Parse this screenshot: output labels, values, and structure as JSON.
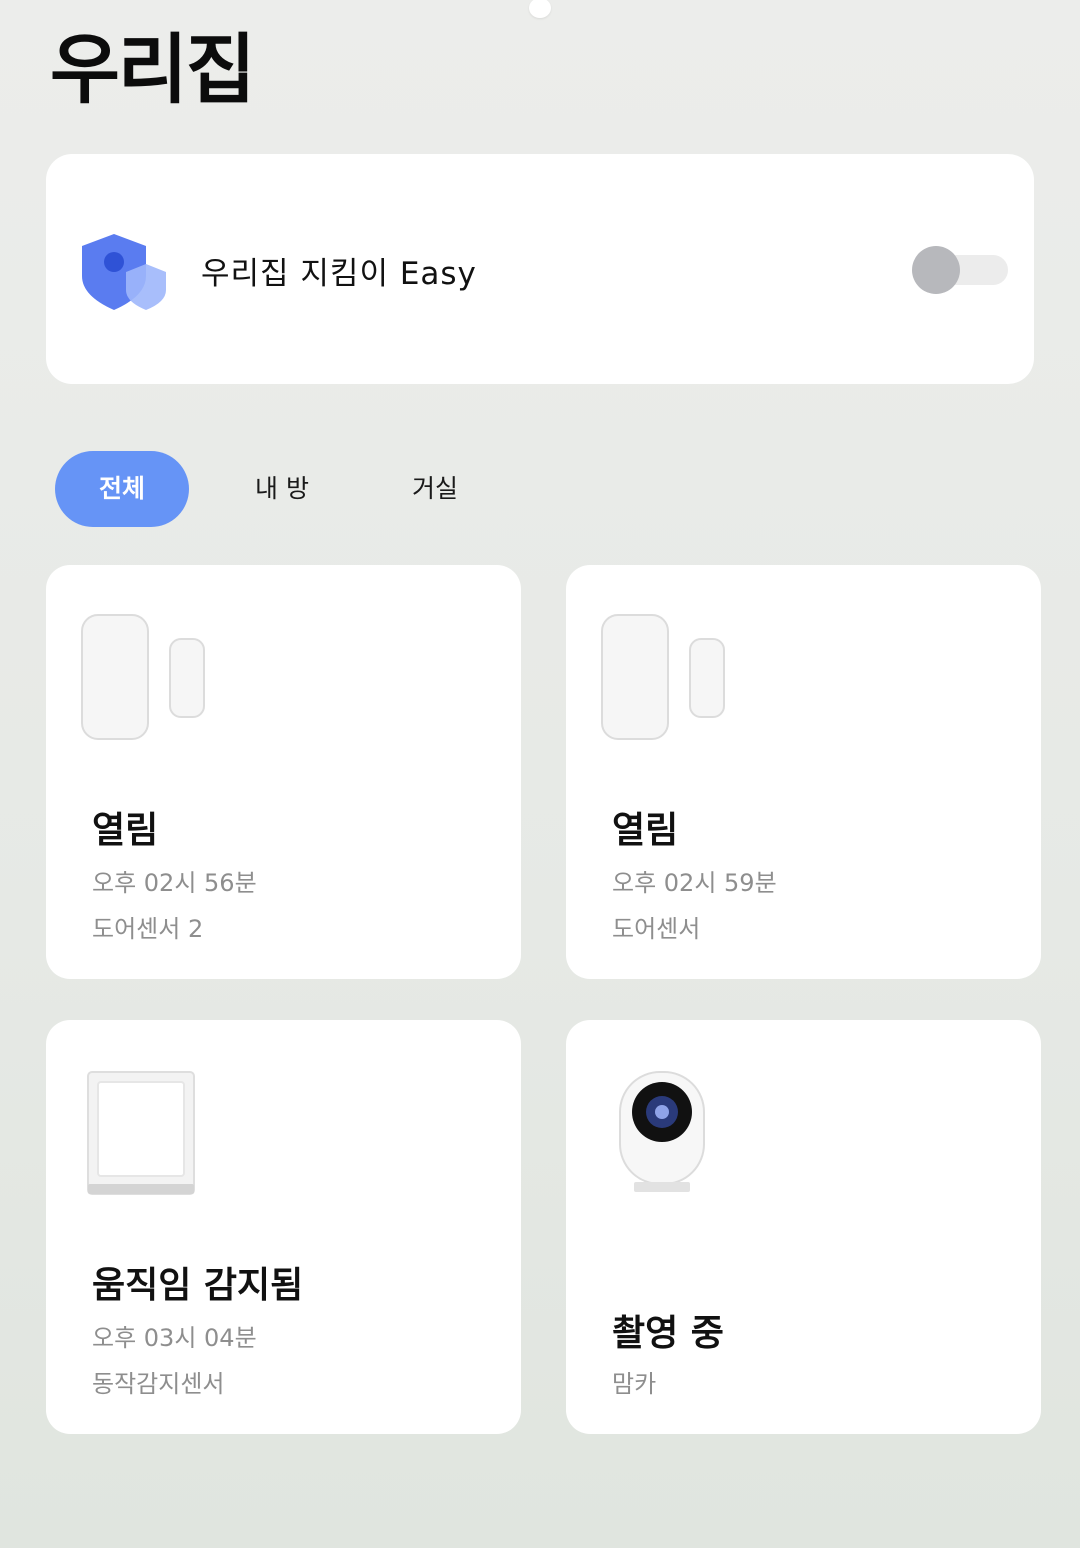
{
  "page": {
    "title": "우리집"
  },
  "mode": {
    "title": "우리집 지킴이 Easy",
    "enabled": false,
    "icon": "shield-icon",
    "accent_color": "#5a7cf0"
  },
  "tabs": [
    {
      "label": "전체",
      "active": true
    },
    {
      "label": "내 방",
      "active": false
    },
    {
      "label": "거실",
      "active": false
    }
  ],
  "devices": [
    {
      "status": "열림",
      "time": "오후 02시 56분",
      "name": "도어센서 2",
      "icon": "door-sensor-icon"
    },
    {
      "status": "열림",
      "time": "오후 02시 59분",
      "name": "도어센서",
      "icon": "door-sensor-icon"
    },
    {
      "status": "움직임 감지됨",
      "time": "오후 03시 04분",
      "name": "동작감지센서",
      "icon": "motion-sensor-icon"
    },
    {
      "status": "촬영 중",
      "name": "맘카",
      "icon": "camera-icon"
    }
  ],
  "colors": {
    "active_tab": "#6694f6",
    "card_bg": "#ffffff",
    "secondary_text": "#8e8e8e"
  }
}
